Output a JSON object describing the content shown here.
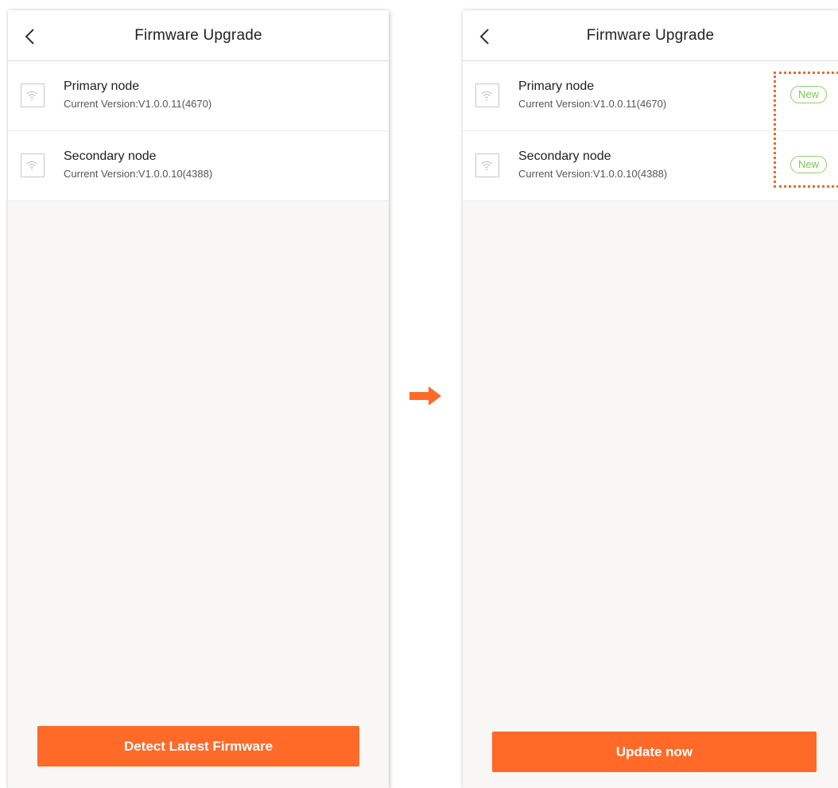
{
  "left_screen": {
    "title": "Firmware Upgrade",
    "nodes": [
      {
        "name": "Primary node",
        "version": "Current Version:V1.0.0.11(4670)"
      },
      {
        "name": "Secondary node",
        "version": "Current Version:V1.0.0.10(4388)"
      }
    ],
    "button_label": "Detect Latest Firmware"
  },
  "right_screen": {
    "title": "Firmware Upgrade",
    "nodes": [
      {
        "name": "Primary node",
        "version": "Current Version:V1.0.0.11(4670)",
        "badge": "New"
      },
      {
        "name": "Secondary node",
        "version": "Current Version:V1.0.0.10(4388)",
        "badge": "New"
      }
    ],
    "button_label": "Update now"
  },
  "colors": {
    "accent": "#ff6a29",
    "badge_green": "#7cc555",
    "highlight_dots": "#ec6a2a",
    "background": "#f8f7f5"
  },
  "icons": {
    "back": "chevron-left-icon",
    "node": "wifi-icon",
    "transition": "arrow-right-icon"
  }
}
